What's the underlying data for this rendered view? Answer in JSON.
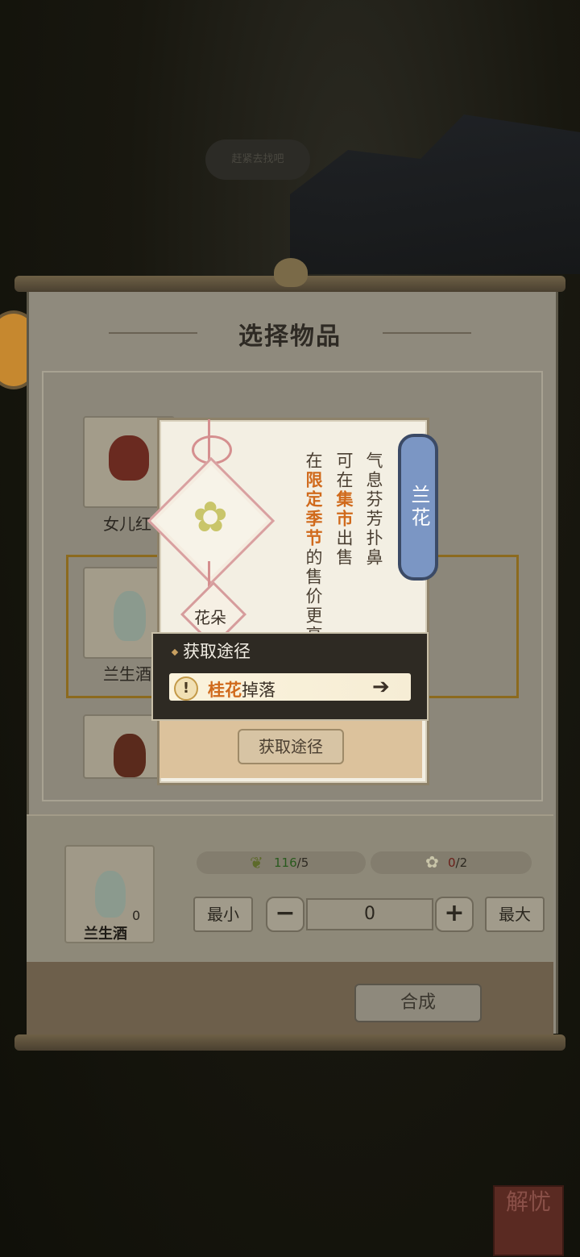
{
  "background": {
    "bubble_text": "赶紧去找吧"
  },
  "panel": {
    "title": "选择物品"
  },
  "list": {
    "items": [
      {
        "label": "女儿红"
      },
      {
        "label": "兰生酒"
      },
      {
        "label": ""
      }
    ]
  },
  "detail": {
    "name": "兰花",
    "category": "花朵",
    "desc_line1": "气息芬芳扑鼻",
    "desc_line2_a": "可在",
    "desc_line2_hl": "集市",
    "desc_line2_b": "出售",
    "desc_line3_a": "在",
    "desc_line3_hl": "限定季节",
    "desc_line3_b": "的售价更高",
    "source_button": "获取途径"
  },
  "tooltip": {
    "title": "获取途径",
    "row_highlight": "桂花",
    "row_text": "掉落",
    "arrow": "➔"
  },
  "craft": {
    "slot_count": "0",
    "slot_name": "兰生酒",
    "mat1_have": "116",
    "mat1_need": "/5",
    "mat2_have": "0",
    "mat2_need": "/2",
    "min_label": "最小",
    "max_label": "最大",
    "minus": "−",
    "plus": "+",
    "quantity": "0",
    "synth_label": "合成"
  },
  "corner": {
    "stamp_text": "解忧"
  },
  "colors": {
    "accent": "#d06a1c",
    "tab_blue": "#7b96c4",
    "selected_border": "#8c6a1e"
  }
}
